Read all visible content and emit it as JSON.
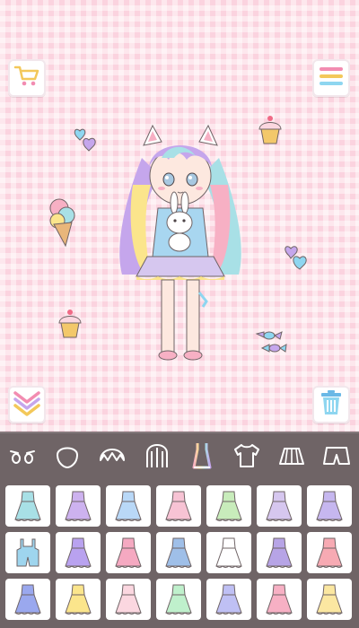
{
  "stage": {
    "top_left_button": {
      "icon": "shopping-cart-icon"
    },
    "top_right_button": {
      "icon": "menu-icon"
    },
    "bottom_left_button": {
      "icon": "chevron-down-icon"
    },
    "bottom_right_button": {
      "icon": "trash-icon"
    },
    "stickers": [
      "hearts-sticker",
      "ice-cream-sticker",
      "cupcake-sticker",
      "hearts-sticker",
      "cupcake-sticker",
      "candy-sticker"
    ]
  },
  "toolbar": {
    "tabs": [
      {
        "icon": "eyes-icon"
      },
      {
        "icon": "face-icon"
      },
      {
        "icon": "bangs-icon"
      },
      {
        "icon": "hair-icon"
      },
      {
        "icon": "dress-icon",
        "selected": true
      },
      {
        "icon": "shirt-icon"
      },
      {
        "icon": "skirt-icon"
      },
      {
        "icon": "shorts-icon"
      }
    ]
  },
  "colors": {
    "background": "#fbd3df",
    "panel": "#6f6466",
    "accent_blue": "#8ed6f0",
    "accent_pink": "#f6b3c6",
    "accent_purple": "#c5a6ec",
    "accent_yellow": "#fbe58c"
  },
  "wardrobe": {
    "items": [
      {
        "kind": "dress",
        "color": "#a8e0e6"
      },
      {
        "kind": "dress",
        "color": "#cdb2ef"
      },
      {
        "kind": "dress",
        "color": "#b9d8f7"
      },
      {
        "kind": "dress",
        "color": "#f7c3d4"
      },
      {
        "kind": "dress",
        "color": "#c8ecbb"
      },
      {
        "kind": "dress",
        "color": "#d6c7ef"
      },
      {
        "kind": "dress",
        "color": "#c6b7ef"
      },
      {
        "kind": "overalls",
        "color": "#9ed5ee"
      },
      {
        "kind": "dress",
        "color": "#b9a2ef"
      },
      {
        "kind": "dress",
        "color": "#f5a9c1"
      },
      {
        "kind": "dress",
        "color": "#9fbfe8"
      },
      {
        "kind": "dress",
        "color": "#ffffff"
      },
      {
        "kind": "dress",
        "color": "#b7a4e6"
      },
      {
        "kind": "dress",
        "color": "#f7aab3"
      },
      {
        "kind": "dress",
        "color": "#9aa8ee"
      },
      {
        "kind": "dress",
        "color": "#fbe58c"
      },
      {
        "kind": "dress",
        "color": "#fbd7e0"
      },
      {
        "kind": "dress",
        "color": "#bff0cc"
      },
      {
        "kind": "dress",
        "color": "#bfc0f4"
      },
      {
        "kind": "dress",
        "color": "#f7b0c4"
      },
      {
        "kind": "dress",
        "color": "#fbe7a1"
      }
    ]
  }
}
